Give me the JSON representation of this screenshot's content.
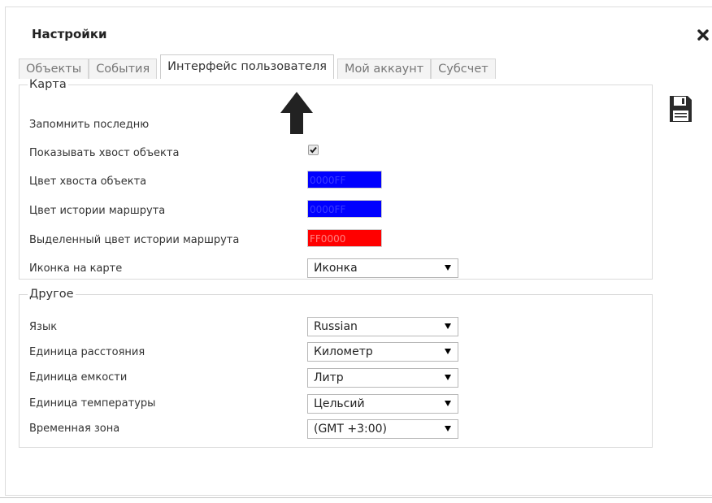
{
  "window": {
    "title": "Настройки"
  },
  "tabs": [
    {
      "label": "Объекты"
    },
    {
      "label": "События"
    },
    {
      "label": "Интерфейс пользователя"
    },
    {
      "label": "Мой аккаунт"
    },
    {
      "label": "Субсчет"
    }
  ],
  "active_tab": "Интерфейс пользователя",
  "map_group": {
    "legend": "Карта",
    "remember_last_label": "Запомнить последню",
    "show_tail_label": "Показывать хвост объекта",
    "show_tail_checked": true,
    "tail_color_label": "Цвет хвоста объекта",
    "tail_color_value": "0000FF",
    "route_color_label": "Цвет истории маршрута",
    "route_color_value": "0000FF",
    "selected_route_color_label": "Выделенный цвет истории маршрута",
    "selected_route_color_value": "FF0000",
    "map_icon_label": "Иконка на карте",
    "map_icon_value": "Иконка"
  },
  "other_group": {
    "legend": "Другое",
    "language_label": "Язык",
    "language_value": "Russian",
    "distance_unit_label": "Единица расстояния",
    "distance_unit_value": "Километр",
    "capacity_unit_label": "Единица емкости",
    "capacity_unit_value": "Литр",
    "temperature_unit_label": "Единица температуры",
    "temperature_unit_value": "Цельсий",
    "timezone_label": "Временная зона",
    "timezone_value": "(GMT +3:00)"
  },
  "colors": {
    "blue_swatch": "#0000ff",
    "blue_text": "#3a3aff",
    "red_swatch": "#ff0000",
    "red_text": "#ff8080"
  },
  "icons": {
    "close": "close-icon",
    "save": "floppy-disk-icon",
    "arrow": "up-arrow-icon",
    "checkbox": "checkmark-icon",
    "dropdown": "triangle-down-icon"
  }
}
